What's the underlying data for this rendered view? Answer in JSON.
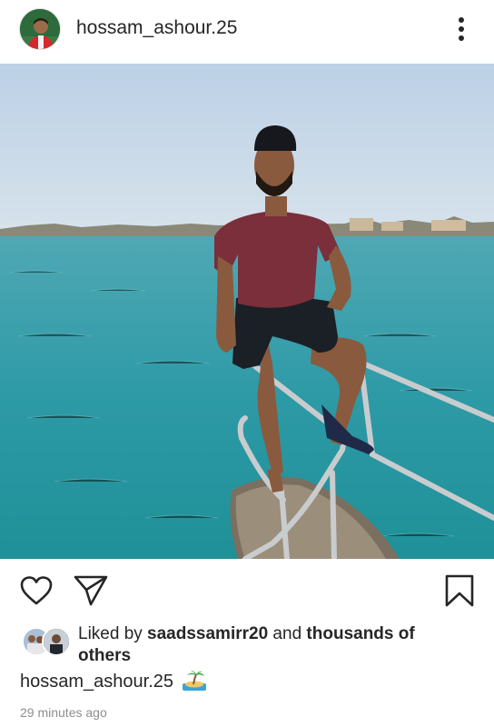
{
  "post": {
    "username": "hossam_ashour.25",
    "likes": {
      "prefix": "Liked by ",
      "user": "saadssamirr20",
      "middle": " and ",
      "others": "thousands of others"
    },
    "caption": {
      "username": "hossam_ashour.25",
      "emoji": "desert-island-emoji"
    },
    "timestamp": "29 minutes ago"
  },
  "icons": {
    "more": "more-vertical-icon",
    "like": "heart-icon",
    "share": "paper-plane-icon",
    "save": "bookmark-icon"
  },
  "colors": {
    "text": "#262626",
    "muted": "#8e8e8e",
    "background": "#ffffff"
  }
}
